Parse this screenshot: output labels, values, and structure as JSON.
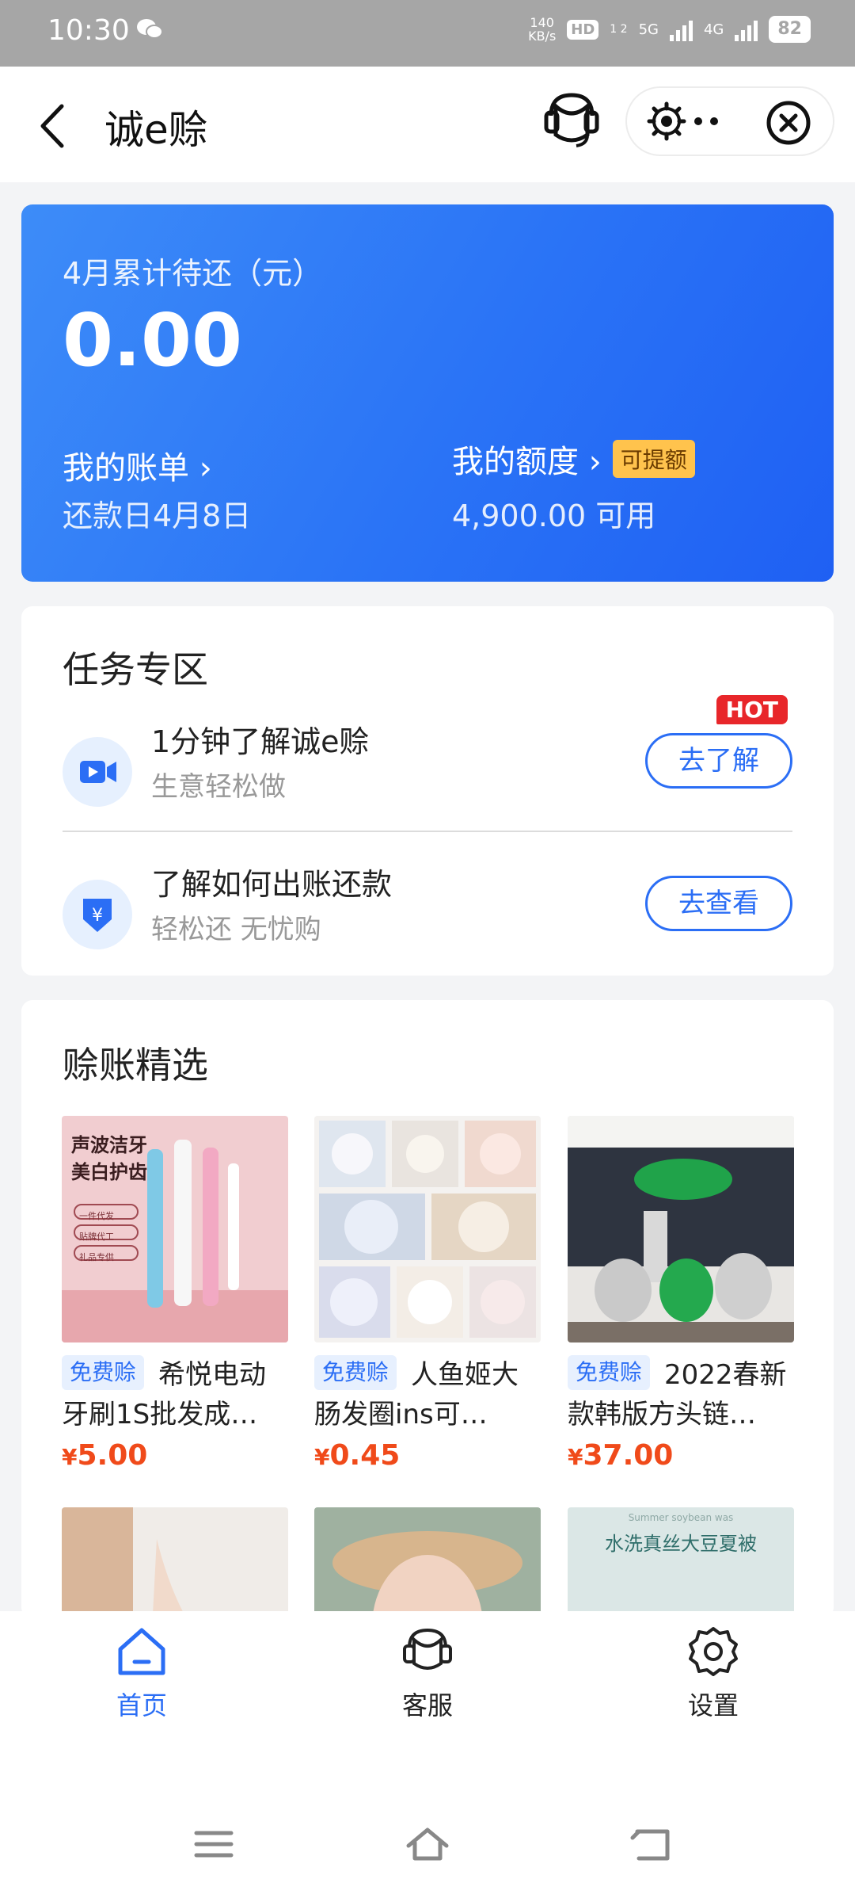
{
  "status_bar": {
    "time": "10:30",
    "net_speed_top": "140",
    "net_speed_bottom": "KB/s",
    "hd": "HD",
    "hd_sub": "1 2",
    "sig1": "5G",
    "sig2": "4G",
    "battery": "82"
  },
  "header": {
    "title": "诚e赊"
  },
  "balance": {
    "label": "4月累计待还（元）",
    "amount": "0.00",
    "bill_label": "我的账单 ›",
    "bill_date": "还款日4月8日",
    "quota_label": "我的额度 ›",
    "quota_tag": "可提额",
    "quota_available": "4,900.00 可用"
  },
  "tasks": {
    "title": "任务专区",
    "items": [
      {
        "title": "1分钟了解诚e赊",
        "subtitle": "生意轻松做",
        "button": "去了解",
        "badge": "HOT"
      },
      {
        "title": "了解如何出账还款",
        "subtitle": "轻松还 无忧购",
        "button": "去查看"
      }
    ]
  },
  "products": {
    "title": "赊账精选",
    "items": [
      {
        "tag": "免费赊",
        "name": "希悦电动牙刷1S批发成…",
        "currency": "¥",
        "price": "5.00",
        "pic_text_1": "声波洁牙",
        "pic_text_2": "美白护齿",
        "pic_chip_1": "一件代发",
        "pic_chip_2": "贴牌代工",
        "pic_chip_3": "礼品专供"
      },
      {
        "tag": "免费赊",
        "name": "人鱼姬大肠发圈ins可…",
        "currency": "¥",
        "price": "0.45"
      },
      {
        "tag": "免费赊",
        "name": "2022春新款韩版方头链…",
        "currency": "¥",
        "price": "37.00"
      }
    ],
    "row2_pic_text": "水洗真丝大豆夏被",
    "row2_pic_sub": "Summer soybean was"
  },
  "tabbar": {
    "home": "首页",
    "service": "客服",
    "settings": "设置"
  },
  "colors": {
    "primary": "#2b6ef5",
    "price": "#f04a1a",
    "hot": "#e8262a"
  }
}
